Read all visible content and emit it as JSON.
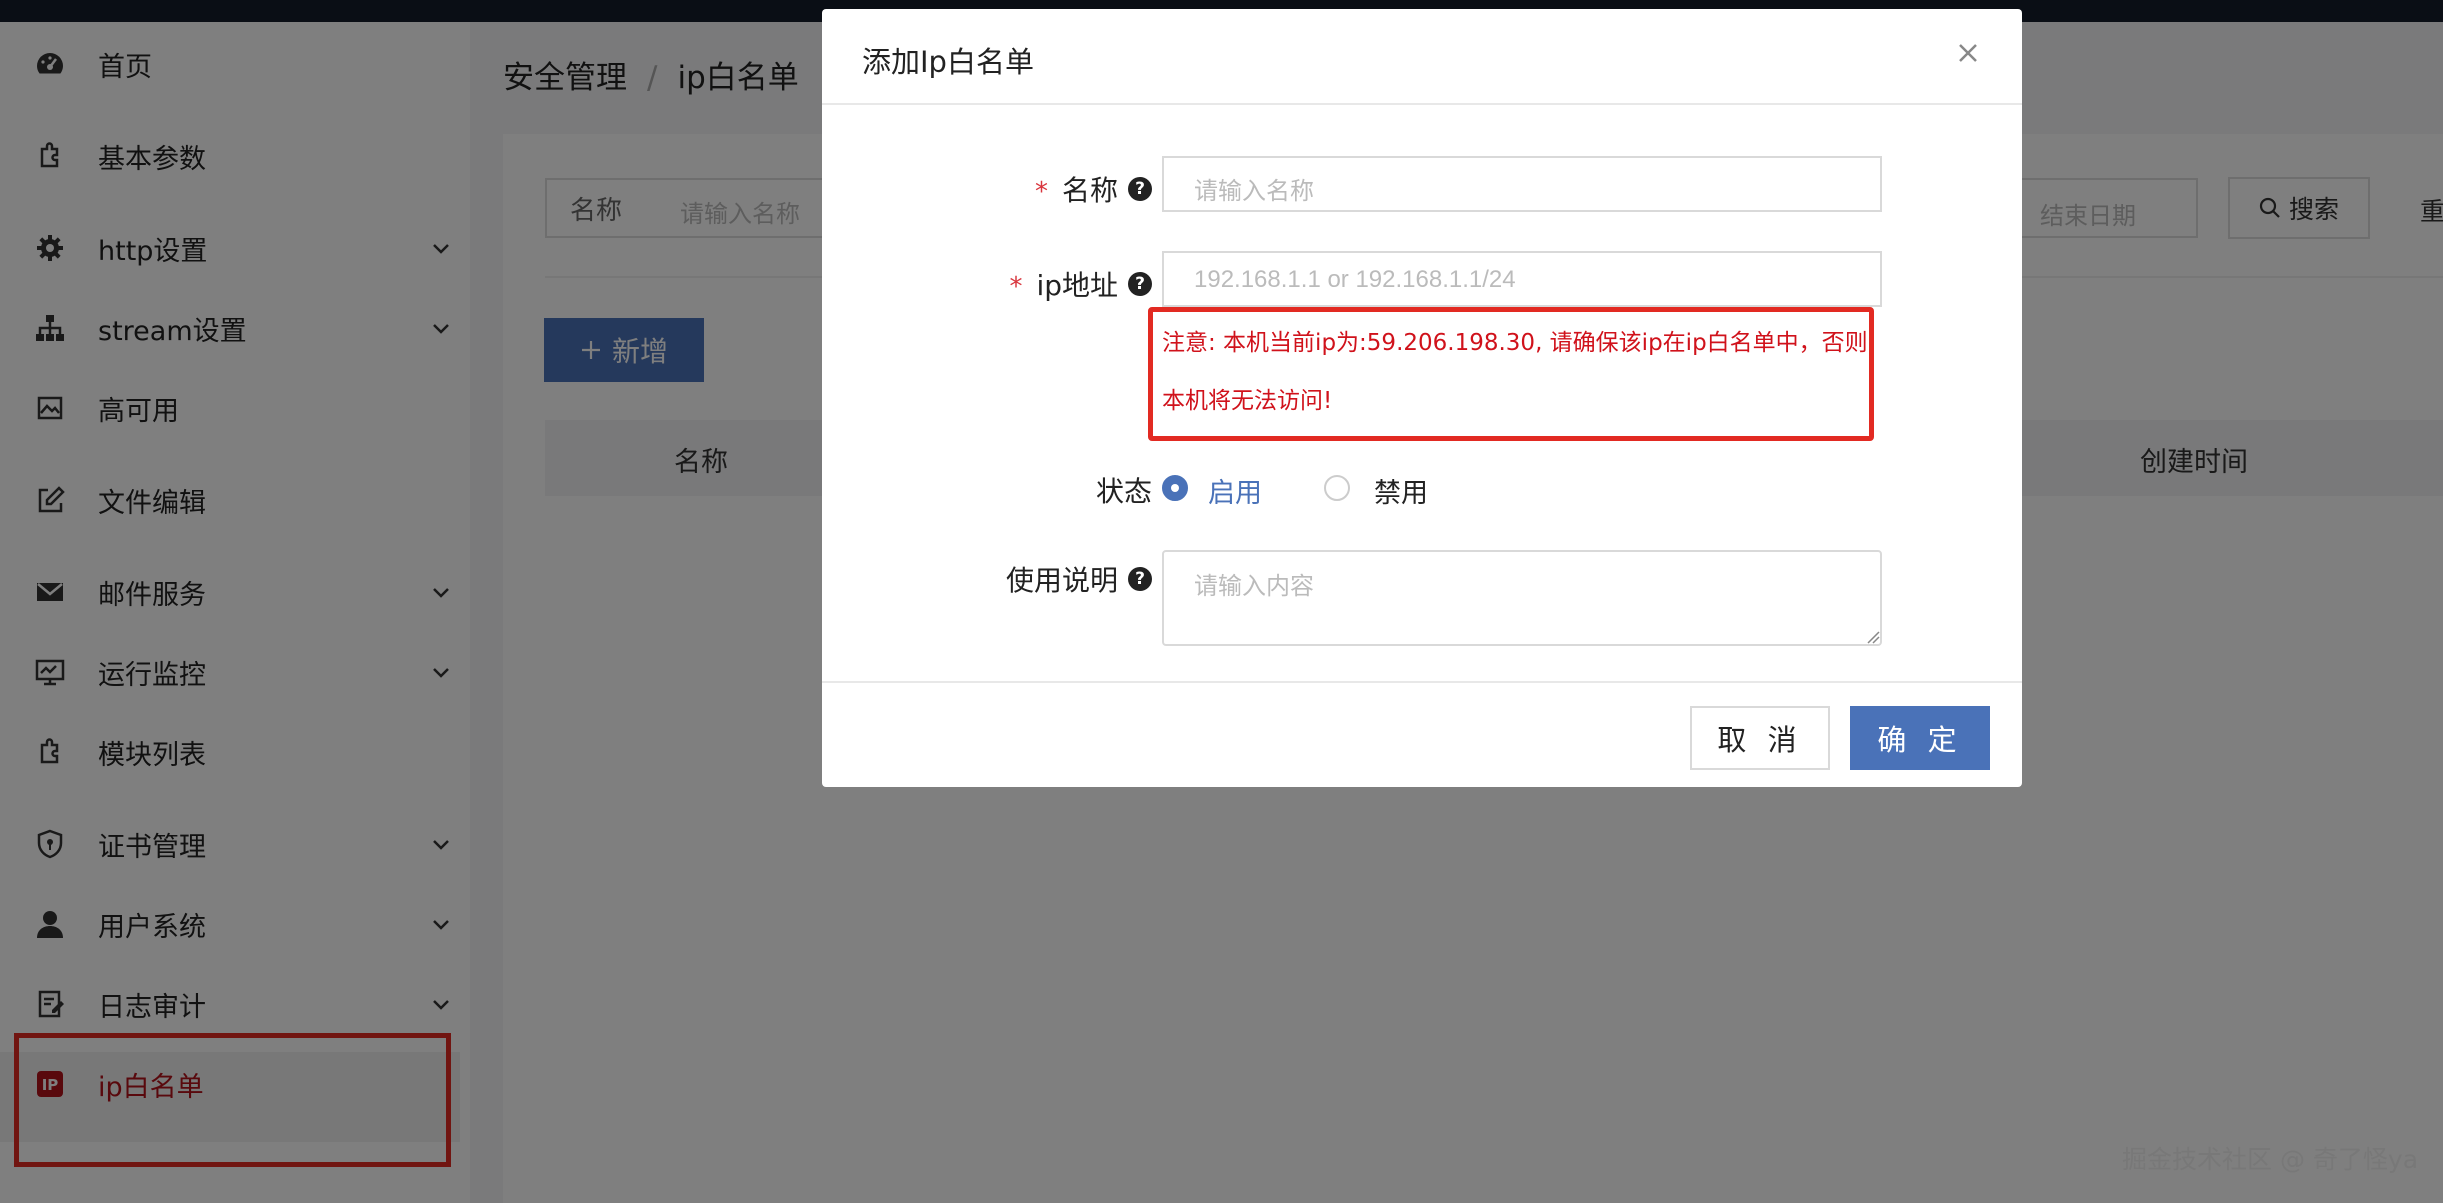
{
  "sidebar": {
    "items": [
      {
        "label": "首页",
        "icon": "dashboard-icon",
        "chevron": false
      },
      {
        "label": "基本参数",
        "icon": "plugin-icon",
        "chevron": false
      },
      {
        "label": "http设置",
        "icon": "gear-icon",
        "chevron": true
      },
      {
        "label": "stream设置",
        "icon": "sitemap-icon",
        "chevron": true
      },
      {
        "label": "高可用",
        "icon": "image-icon",
        "chevron": false
      },
      {
        "label": "文件编辑",
        "icon": "edit-icon",
        "chevron": false
      },
      {
        "label": "邮件服务",
        "icon": "mail-icon",
        "chevron": true
      },
      {
        "label": "运行监控",
        "icon": "monitor-icon",
        "chevron": true
      },
      {
        "label": "模块列表",
        "icon": "plugin-icon",
        "chevron": false
      },
      {
        "label": "证书管理",
        "icon": "shield-icon",
        "chevron": true
      },
      {
        "label": "用户系统",
        "icon": "user-icon",
        "chevron": true
      },
      {
        "label": "日志审计",
        "icon": "log-icon",
        "chevron": true
      },
      {
        "label": "ip白名单",
        "icon": "ip-icon",
        "chevron": false,
        "active": true
      }
    ]
  },
  "breadcrumb": {
    "parent": "安全管理",
    "separator": "/",
    "current": "ip白名单"
  },
  "filters": {
    "name_label": "名称",
    "name_placeholder": "请输入名称",
    "end_date_placeholder": "结束日期",
    "search_label": "搜索",
    "reset_label": "重"
  },
  "toolbar": {
    "add_label": "新增"
  },
  "table": {
    "columns": [
      "名称",
      "创建时间"
    ]
  },
  "modal": {
    "title": "添加Ip白名单",
    "fields": {
      "name": {
        "required_mark": "*",
        "label": "名称",
        "help": "?",
        "placeholder": "请输入名称"
      },
      "ip": {
        "required_mark": "*",
        "label": "ip地址",
        "help": "?",
        "placeholder": "192.168.1.1 or 192.168.1.1/24"
      },
      "warning": {
        "line1": "注意: 本机当前ip为:59.206.198.30, 请确保该ip在ip白名单中，否则",
        "line2": "本机将无法访问!"
      },
      "status": {
        "label": "状态",
        "options": [
          "启用",
          "禁用"
        ],
        "selected": "启用"
      },
      "description": {
        "label": "使用说明",
        "help": "?",
        "placeholder": "请输入内容"
      }
    },
    "buttons": {
      "cancel": "取 消",
      "ok": "确 定"
    }
  },
  "watermark": "掘金技术社区 @ 奇了怪ya",
  "colors": {
    "primary": "#4a72b8",
    "danger": "#d0121b",
    "highlight_border": "#e22a22",
    "active_nav": "#b3121b"
  }
}
